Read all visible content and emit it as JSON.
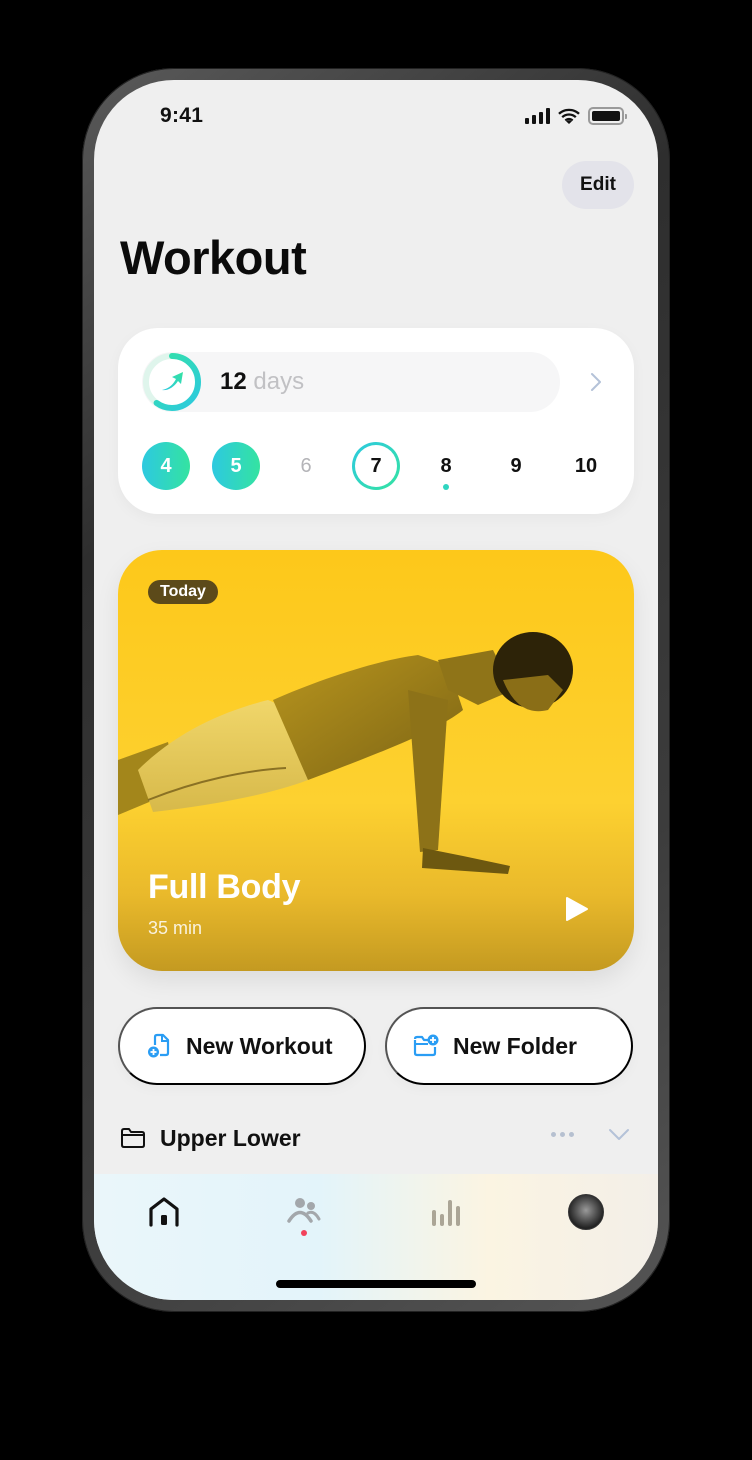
{
  "status_bar": {
    "time": "9:41",
    "icons": [
      "cellular-signal-icon",
      "wifi-icon",
      "battery-icon"
    ]
  },
  "header": {
    "edit_label": "Edit",
    "title": "Workout"
  },
  "streak": {
    "count": "12",
    "unit": "days",
    "progress": 0.6,
    "icon": "trending-up-arrow-icon",
    "chevron": "chevron-right-icon",
    "days": [
      {
        "label": "4",
        "state": "done"
      },
      {
        "label": "5",
        "state": "done"
      },
      {
        "label": "6",
        "state": "past"
      },
      {
        "label": "7",
        "state": "today"
      },
      {
        "label": "8",
        "state": "scheduled",
        "dot": true
      },
      {
        "label": "9",
        "state": "upcoming"
      },
      {
        "label": "10",
        "state": "upcoming"
      }
    ],
    "colors": {
      "gradient_start": "#2dc9e0",
      "gradient_end": "#34e3a1"
    }
  },
  "today_card": {
    "badge": "Today",
    "title": "Full Body",
    "duration": "35 min",
    "image": "man-doing-plank-photo",
    "play_icon": "play-icon",
    "color": "#fdc81a"
  },
  "actions": {
    "new_workout": "New Workout",
    "new_folder": "New Folder",
    "accent": "#2a9df4"
  },
  "folder": {
    "name": "Upper Lower",
    "more_icon": "ellipsis-icon",
    "expand_icon": "chevron-down-icon"
  },
  "tabbar": {
    "tabs": [
      {
        "name": "home",
        "icon": "home-icon",
        "active": true
      },
      {
        "name": "community",
        "icon": "people-icon",
        "badge": true
      },
      {
        "name": "stats",
        "icon": "bar-chart-icon"
      },
      {
        "name": "profile",
        "icon": "avatar"
      }
    ],
    "badge_color": "#f2415a"
  }
}
